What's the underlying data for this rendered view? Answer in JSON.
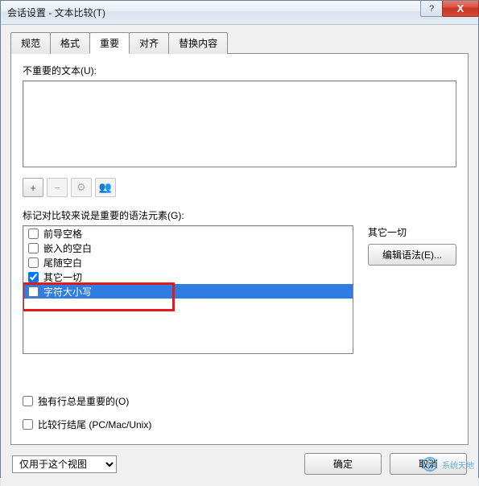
{
  "window": {
    "title": "会话设置 - 文本比较(T)"
  },
  "titlebar_buttons": {
    "help": "?",
    "close": "X"
  },
  "tabs": [
    {
      "label": "规范"
    },
    {
      "label": "格式"
    },
    {
      "label": "重要",
      "active": true
    },
    {
      "label": "对齐"
    },
    {
      "label": "替换内容"
    }
  ],
  "labels": {
    "unimportant_text": "不重要的文本(U):",
    "grammar_label": "标记对比较来说是重要的语法元素(G):",
    "everything_else": "其它一切",
    "edit_grammar_btn": "编辑语法(E)...",
    "lone_lines": "独有行总是重要的(O)",
    "line_endings": "比较行结尾 (PC/Mac/Unix)",
    "scope_select": "仅用于这个视图",
    "ok": "确定",
    "cancel": "取消"
  },
  "toolbar": {
    "add": "+",
    "remove": "−",
    "gear": "⚙",
    "group": "👥"
  },
  "grammar_items": [
    {
      "label": "前导空格",
      "checked": false
    },
    {
      "label": "嵌入的空白",
      "checked": false
    },
    {
      "label": "尾随空白",
      "checked": false
    },
    {
      "label": "其它一切",
      "checked": true
    },
    {
      "label": "字符大小写",
      "checked": false,
      "selected": true
    }
  ],
  "watermark": "系统天地"
}
